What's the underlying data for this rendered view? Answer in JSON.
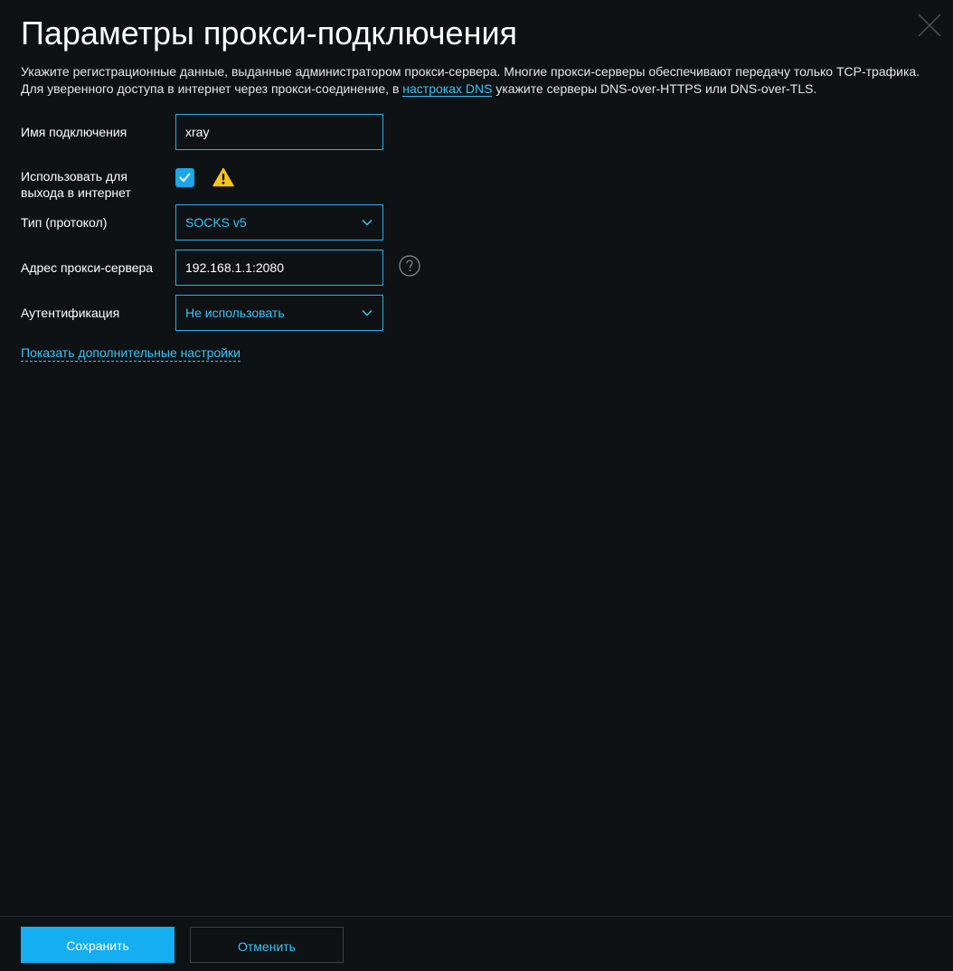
{
  "dialog": {
    "title": "Параметры прокси-подключения",
    "description_part1": "Укажите регистрационные данные, выданные администратором прокси-сервера. Многие прокси-серверы обеспечивают передачу только TCP-трафика. Для уверенного доступа в интернет через прокси-соединение, в ",
    "description_link": "настроках DNS",
    "description_part2": " укажите серверы DNS-over-HTTPS или DNS-over-TLS.",
    "close_icon": "close-icon"
  },
  "form": {
    "connection_name": {
      "label": "Имя подключения",
      "value": "xray"
    },
    "use_for_internet": {
      "label_line1": "Использовать для",
      "label_line2": "выхода в интернет",
      "checked": true,
      "warning_icon": "warning-icon"
    },
    "protocol": {
      "label": "Тип (протокол)",
      "value": "SOCKS v5"
    },
    "proxy_address": {
      "label": "Адрес прокси-сервера",
      "value": "192.168.1.1:2080",
      "help_icon": "help-icon"
    },
    "authentication": {
      "label": "Аутентификация",
      "value": "Не использовать"
    },
    "more_settings_link": "Показать дополнительные настройки"
  },
  "footer": {
    "save_label": "Сохранить",
    "cancel_label": "Отменить"
  },
  "colors": {
    "background": "#0e1215",
    "accent": "#14aef1",
    "link": "#39c4f6",
    "warning": "#f5c518"
  }
}
